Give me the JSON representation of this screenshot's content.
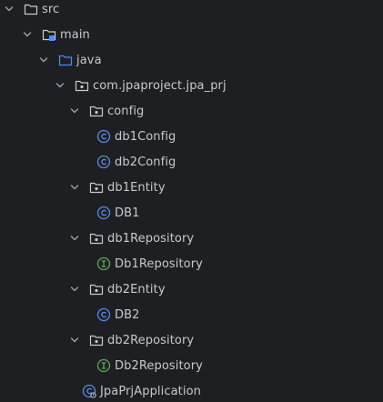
{
  "colors": {
    "background": "#1e1f22",
    "text": "#c8c9cd",
    "folder_stroke": "#c8c9cd",
    "source_folder": "#4f8bf7",
    "class_icon": "#5a8ae6",
    "interface_icon": "#5fa85f"
  },
  "tree": {
    "src": "src",
    "main": "main",
    "java": "java",
    "package": "com.jpaproject.jpa_prj",
    "config": "config",
    "db1Config": "db1Config",
    "db2Config": "db2Config",
    "db1Entity": "db1Entity",
    "DB1": "DB1",
    "db1Repository": "db1Repository",
    "Db1Repository": "Db1Repository",
    "db2Entity": "db2Entity",
    "DB2": "DB2",
    "db2Repository": "db2Repository",
    "Db2Repository": "Db2Repository",
    "JpaPrjApplication": "JpaPrjApplication"
  },
  "icons": {
    "expand": "chevron-down-icon",
    "folder": "folder-icon",
    "module_folder": "module-folder-icon",
    "source_folder": "source-folder-icon",
    "package": "package-icon",
    "class": "class-icon",
    "interface": "interface-icon",
    "spring_app": "spring-boot-class-icon"
  }
}
